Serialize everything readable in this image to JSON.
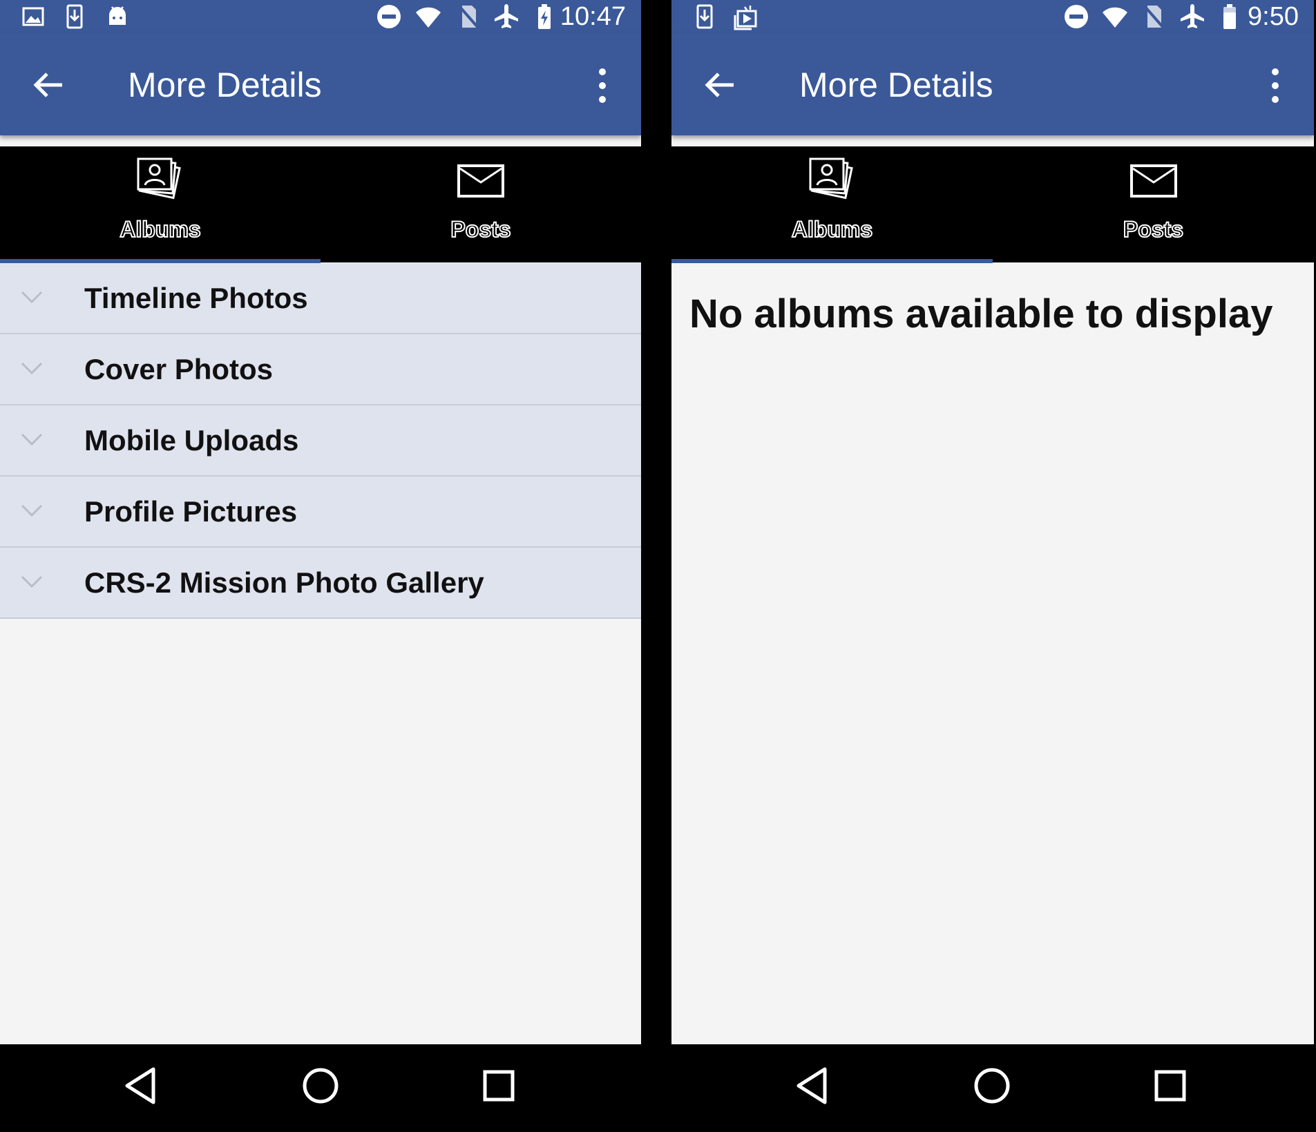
{
  "left_screen": {
    "status_time": "10:47",
    "status_left_icons": [
      "image-notification-icon",
      "download-notification-icon",
      "android-notification-icon"
    ],
    "status_right_icons": [
      "do-not-disturb-icon",
      "wifi-icon",
      "no-sim-icon",
      "airplane-mode-icon",
      "battery-charging-icon"
    ],
    "app_title": "More Details",
    "tabs": [
      {
        "label": "Albums",
        "icon": "albums-icon",
        "selected": true
      },
      {
        "label": "Posts",
        "icon": "envelope-icon",
        "selected": false
      }
    ],
    "albums": [
      {
        "name": "Timeline Photos"
      },
      {
        "name": "Cover Photos"
      },
      {
        "name": "Mobile Uploads"
      },
      {
        "name": "Profile Pictures"
      },
      {
        "name": "CRS-2 Mission Photo Gallery"
      }
    ]
  },
  "right_screen": {
    "status_time": "9:50",
    "status_left_icons": [
      "download-notification-icon",
      "photos-notification-icon"
    ],
    "status_right_icons": [
      "do-not-disturb-icon",
      "wifi-icon",
      "no-sim-icon",
      "airplane-mode-icon",
      "battery-icon"
    ],
    "app_title": "More Details",
    "tabs": [
      {
        "label": "Albums",
        "icon": "albums-icon",
        "selected": true
      },
      {
        "label": "Posts",
        "icon": "envelope-icon",
        "selected": false
      }
    ],
    "empty_message": "No albums available to display"
  },
  "colors": {
    "brand_blue": "#3b5998",
    "list_item_bg": "#dfe3ee",
    "content_bg": "#f4f4f4",
    "bars": "#000000"
  },
  "nav_buttons": [
    "back-triangle-icon",
    "home-circle-icon",
    "recents-square-icon"
  ]
}
